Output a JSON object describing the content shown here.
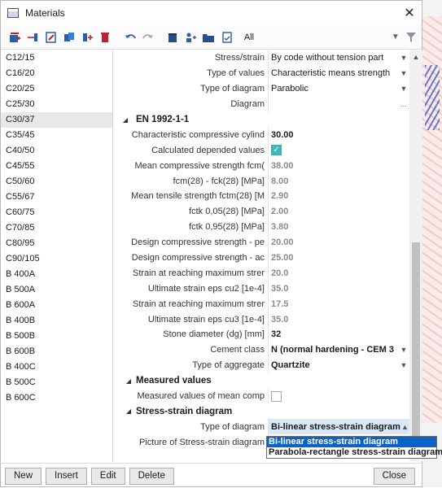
{
  "window": {
    "title": "Materials"
  },
  "toolbar": {
    "filter_value": "All"
  },
  "materials": [
    "C12/15",
    "C16/20",
    "C20/25",
    "C25/30",
    "C30/37",
    "C35/45",
    "C40/50",
    "C45/55",
    "C50/60",
    "C55/67",
    "C60/75",
    "C70/85",
    "C80/95",
    "C90/105",
    "B 400A",
    "B 500A",
    "B 600A",
    "B 400B",
    "B 500B",
    "B 600B",
    "B 400C",
    "B 500C",
    "B 600C"
  ],
  "selected_material": "C30/37",
  "props_top": [
    {
      "label": "Stress/strain",
      "value": "By code without tension part",
      "dd": true
    },
    {
      "label": "Type of values",
      "value": "Characteristic means strength",
      "dd": true
    },
    {
      "label": "Type of diagram",
      "value": "Parabolic",
      "dd": true
    },
    {
      "label": "Diagram",
      "value": "",
      "dots": "..."
    }
  ],
  "sections": {
    "en": "EN 1992-1-1",
    "measured": "Measured values",
    "stress": "Stress-strain diagram"
  },
  "props_en": [
    {
      "label": "Characteristic compressive cylind",
      "value": "30.00",
      "style": "b"
    },
    {
      "label": "Calculated depended values",
      "checkbox": true
    },
    {
      "label": "Mean compressive strength  fcm(",
      "value": "38.00",
      "style": "g"
    },
    {
      "label": "fcm(28) - fck(28) [MPa]",
      "value": "8.00",
      "style": "g"
    },
    {
      "label": "Mean tensile strength fctm(28) [M",
      "value": "2.90",
      "style": "g"
    },
    {
      "label": "fctk 0,05(28) [MPa]",
      "value": "2.00",
      "style": "g"
    },
    {
      "label": "fctk 0,95(28) [MPa]",
      "value": "3.80",
      "style": "g"
    },
    {
      "label": "Design compressive strength - pe",
      "value": "20.00",
      "style": "g"
    },
    {
      "label": "Design compressive strength - ac",
      "value": "25.00",
      "style": "g"
    },
    {
      "label": "Strain at reaching maximum strer",
      "value": "20.0",
      "style": "g"
    },
    {
      "label": "Ultimate strain eps cu2 [1e-4]",
      "value": "35.0",
      "style": "g"
    },
    {
      "label": "Strain at reaching maximum strer",
      "value": "17.5",
      "style": "g"
    },
    {
      "label": "Ultimate strain eps cu3 [1e-4]",
      "value": "35.0",
      "style": "g"
    },
    {
      "label": "Stone diameter (dg) [mm]",
      "value": "32",
      "style": "b"
    },
    {
      "label": "Cement class",
      "value": "N (normal hardening - CEM 3",
      "style": "b",
      "dd": true
    },
    {
      "label": "Type of aggregate",
      "value": "Quartzite",
      "style": "b",
      "dd": true
    }
  ],
  "props_measured": [
    {
      "label": "Measured values of mean comp",
      "checkbox": false
    }
  ],
  "props_stress": [
    {
      "label": "Type of diagram",
      "value": "Bi-linear stress-strain diagram"
    },
    {
      "label": "Picture of Stress-strain diagram",
      "value": ""
    }
  ],
  "dropdown_options": [
    "Bi-linear stress-strain diagram",
    "Parabola-rectangle stress-strain diagram"
  ],
  "buttons": {
    "new": "New",
    "insert": "Insert",
    "edit": "Edit",
    "delete": "Delete",
    "close": "Close"
  }
}
